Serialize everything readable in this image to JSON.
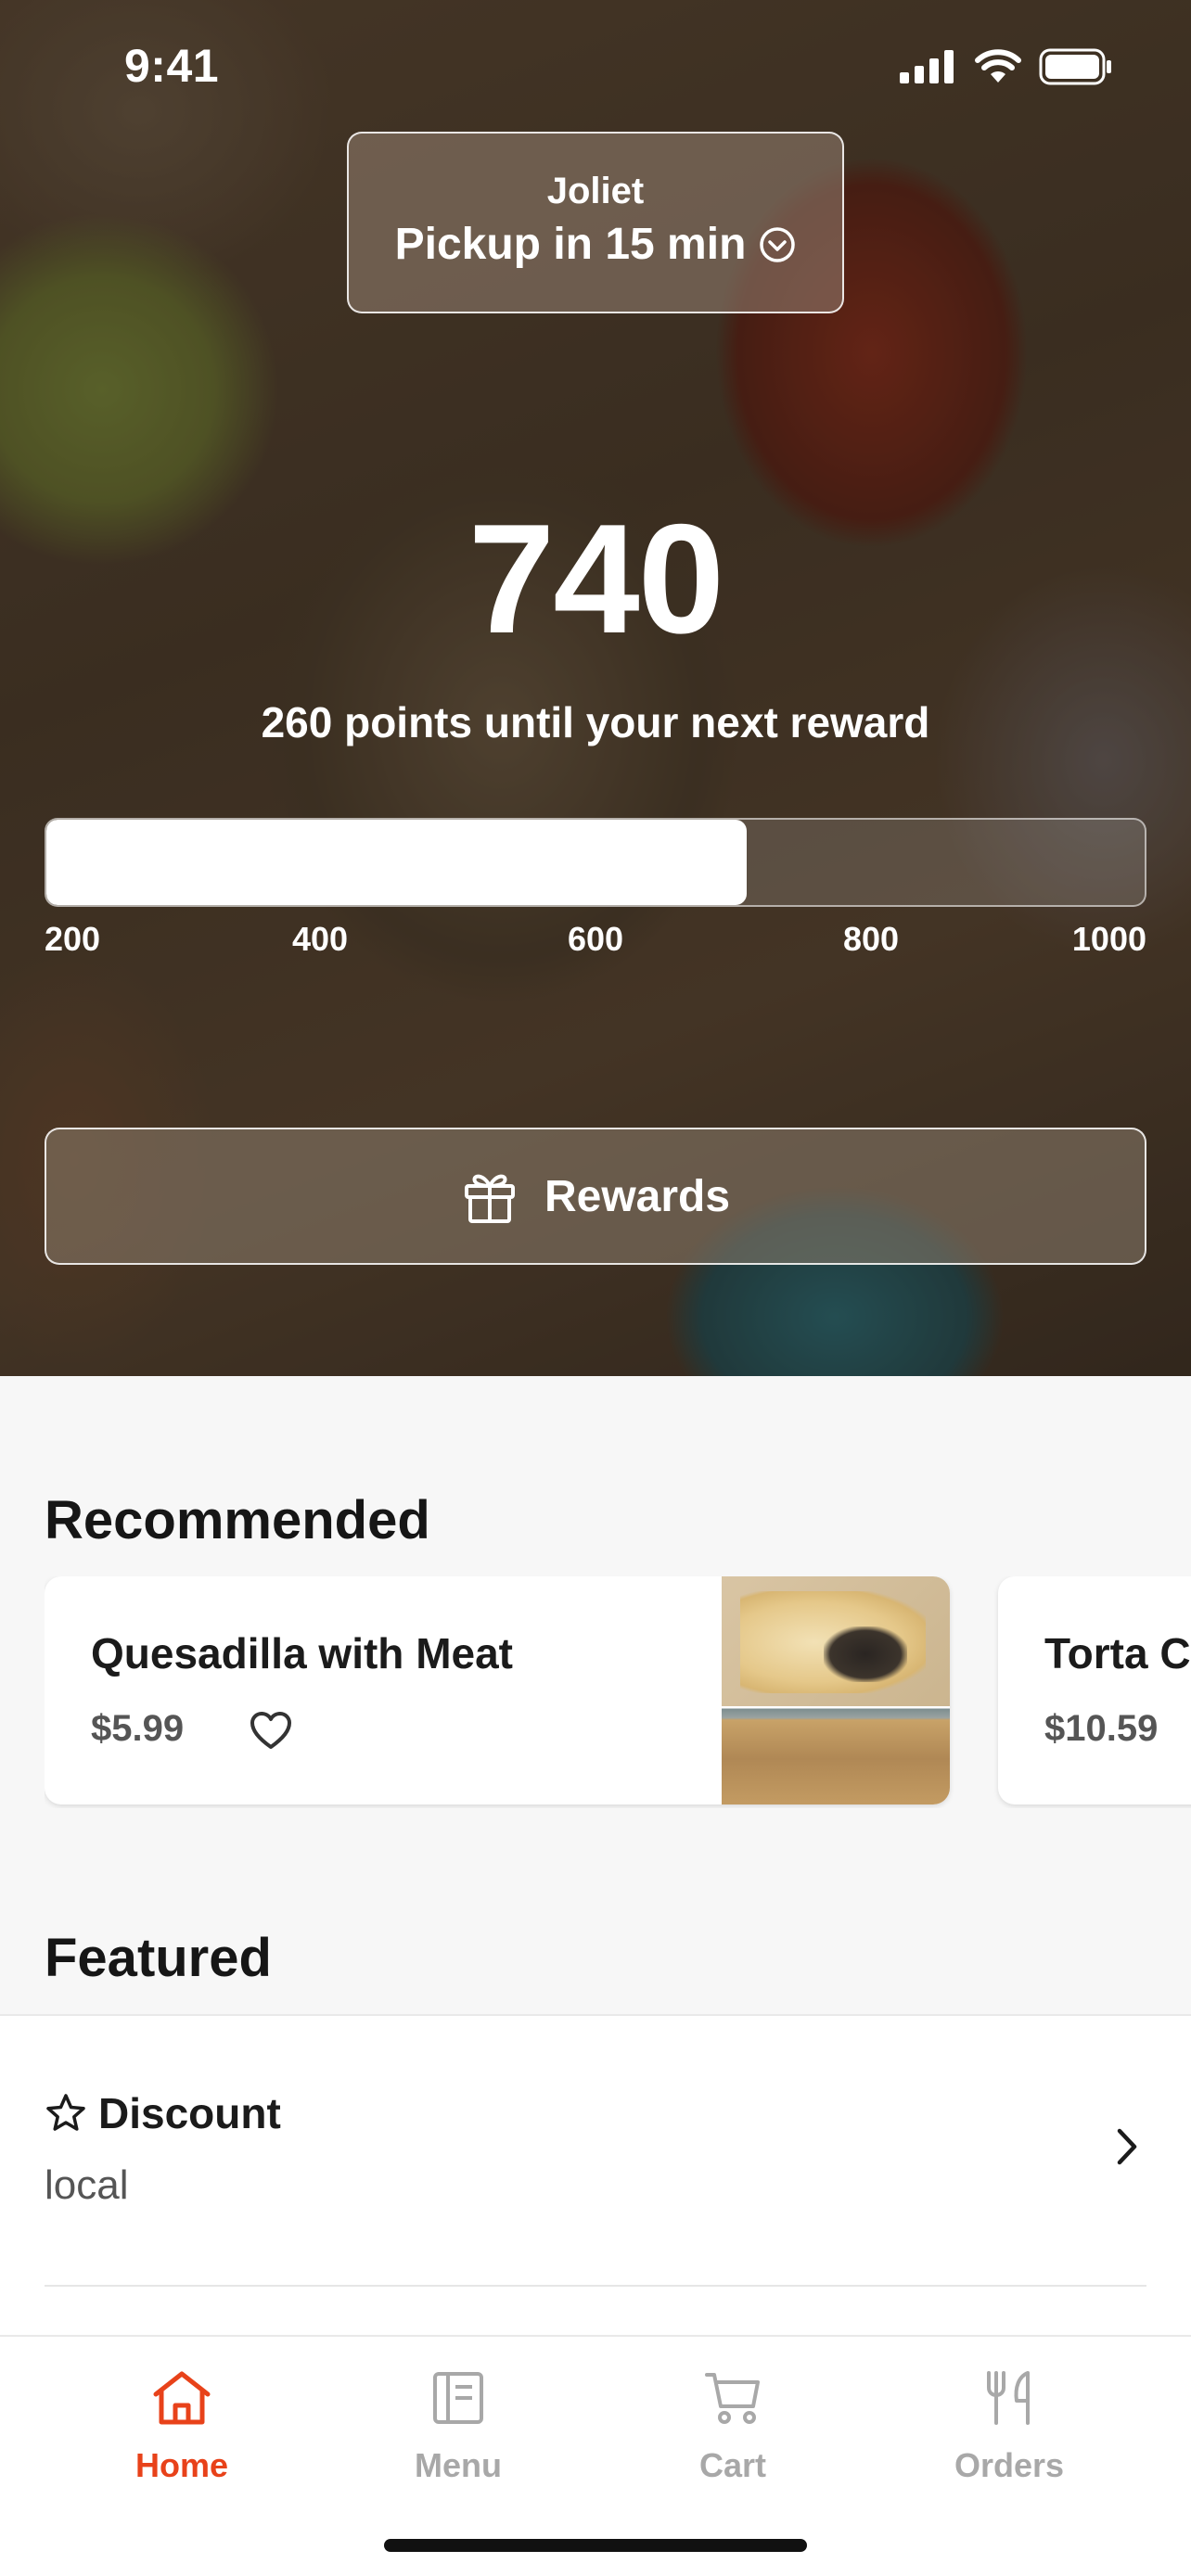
{
  "status_bar": {
    "time": "9:41"
  },
  "location": {
    "city": "Joliet",
    "pickup": "Pickup in 15 min"
  },
  "points": {
    "value": "740",
    "caption": "260 points until your next reward",
    "progress_fraction": 0.6375,
    "scale_labels": [
      "200",
      "400",
      "600",
      "800",
      "1000"
    ]
  },
  "rewards_button": {
    "label": "Rewards"
  },
  "recommended": {
    "title": "Recommended",
    "items": [
      {
        "name": "Quesadilla with Meat",
        "price": "$5.99"
      },
      {
        "name": "Torta C",
        "price": "$10.59"
      }
    ]
  },
  "featured": {
    "title": "Featured",
    "items": [
      {
        "name": "Discount",
        "subtitle": "local"
      }
    ]
  },
  "tabs": [
    {
      "label": "Home",
      "active": true
    },
    {
      "label": "Menu",
      "active": false
    },
    {
      "label": "Cart",
      "active": false
    },
    {
      "label": "Orders",
      "active": false
    }
  ],
  "colors": {
    "accent": "#e8421a",
    "inactive_tab": "#a8a8a8"
  }
}
